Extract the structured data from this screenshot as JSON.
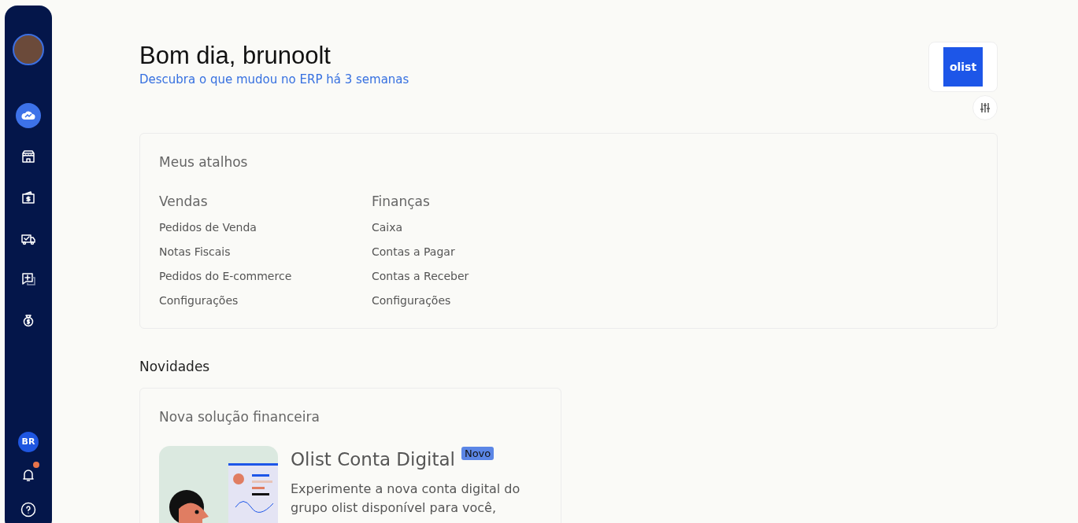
{
  "sidebar": {
    "nav_items": [
      {
        "selected": true
      },
      {
        "selected": false
      },
      {
        "selected": false
      },
      {
        "selected": false
      },
      {
        "selected": false
      },
      {
        "selected": false
      }
    ],
    "initials": "BR",
    "notifications_unread": true
  },
  "header": {
    "greeting": "Bom dia, brunoolt",
    "subtitle_link": "Descubra o que mudou no ERP há 3 semanas",
    "logo_text": "olist"
  },
  "shortcuts": {
    "title": "Meus atalhos",
    "groups": [
      {
        "title": "Vendas",
        "links": [
          "Pedidos de Venda",
          "Notas Fiscais",
          "Pedidos do E-commerce",
          "Configurações"
        ]
      },
      {
        "title": "Finanças",
        "links": [
          "Caixa",
          "Contas a Pagar",
          "Contas a Receber",
          "Configurações"
        ]
      }
    ]
  },
  "news": {
    "title": "Novidades",
    "cards": [
      {
        "eyebrow": "Nova solução financeira",
        "heading": "Olist Conta Digital",
        "badge": "Novo",
        "text": "Experimente a nova conta digital do grupo olist disponível para você,"
      }
    ]
  }
}
